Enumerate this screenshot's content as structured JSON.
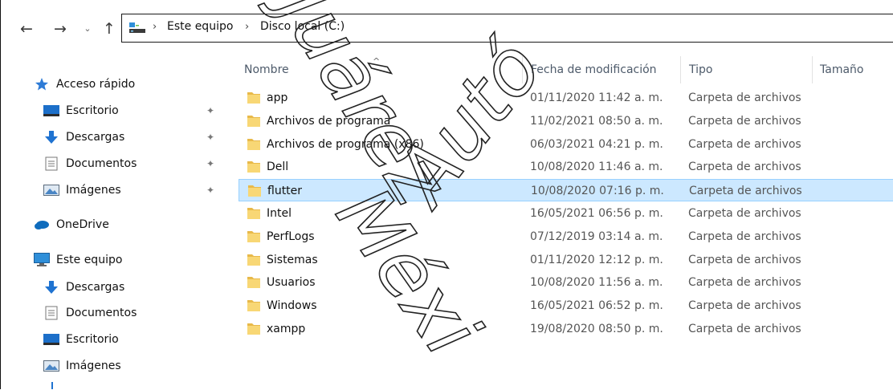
{
  "address": {
    "crumbs": [
      "Este equipo",
      "Disco local (C:)"
    ]
  },
  "nav": {
    "back": "←",
    "forward": "→",
    "recent": "⌄",
    "up": "↑",
    "separator": "›"
  },
  "sidebar": {
    "items": [
      {
        "label": "Acceso rápido",
        "icon": "star-icon",
        "pinned": false
      },
      {
        "label": "Escritorio",
        "icon": "desktop-icon",
        "pinned": true
      },
      {
        "label": "Descargas",
        "icon": "download-icon",
        "pinned": true
      },
      {
        "label": "Documentos",
        "icon": "document-icon",
        "pinned": true
      },
      {
        "label": "Imágenes",
        "icon": "pictures-icon",
        "pinned": true
      },
      {
        "label": "OneDrive",
        "icon": "cloud-icon",
        "pinned": false
      },
      {
        "label": "Este equipo",
        "icon": "computer-icon",
        "pinned": false
      },
      {
        "label": "Descargas",
        "icon": "download-icon",
        "pinned": false
      },
      {
        "label": "Documentos",
        "icon": "document-icon",
        "pinned": false
      },
      {
        "label": "Escritorio",
        "icon": "desktop-icon",
        "pinned": false
      },
      {
        "label": "Imágenes",
        "icon": "pictures-icon",
        "pinned": false
      }
    ],
    "pin_glyph": "📌"
  },
  "columns": {
    "name": "Nombre",
    "date": "Fecha de modificación",
    "type": "Tipo",
    "size": "Tamaño",
    "sort_indicator": "^"
  },
  "files": [
    {
      "name": "app",
      "date": "01/11/2020 11:42 a. m.",
      "type": "Carpeta de archivos",
      "selected": false
    },
    {
      "name": "Archivos de programa",
      "date": "11/02/2021 08:50 a. m.",
      "type": "Carpeta de archivos",
      "selected": false
    },
    {
      "name": "Archivos de programa (x86)",
      "date": "06/03/2021 04:21 p. m.",
      "type": "Carpeta de archivos",
      "selected": false
    },
    {
      "name": "Dell",
      "date": "10/08/2020 11:46 a. m.",
      "type": "Carpeta de archivos",
      "selected": false
    },
    {
      "name": "flutter",
      "date": "10/08/2020 07:16 p. m.",
      "type": "Carpeta de archivos",
      "selected": true
    },
    {
      "name": "Intel",
      "date": "16/05/2021 06:56 p. m.",
      "type": "Carpeta de archivos",
      "selected": false
    },
    {
      "name": "PerfLogs",
      "date": "07/12/2019 03:14 a. m.",
      "type": "Carpeta de archivos",
      "selected": false
    },
    {
      "name": "Sistemas",
      "date": "01/11/2020 12:12 p. m.",
      "type": "Carpeta de archivos",
      "selected": false
    },
    {
      "name": "Usuarios",
      "date": "10/08/2020 11:56 a. m.",
      "type": "Carpeta de archivos",
      "selected": false
    },
    {
      "name": "Windows",
      "date": "16/05/2021 06:52 p. m.",
      "type": "Carpeta de archivos",
      "selected": false
    },
    {
      "name": "xampp",
      "date": "19/08/2020 08:50 p. m.",
      "type": "Carpeta de archivos",
      "selected": false
    }
  ],
  "colors": {
    "selection_bg": "#cce8ff",
    "selection_border": "#99d1ff",
    "folder_yellow": "#f8d775",
    "header_text": "#4d5a6a",
    "star_blue": "#2e7bd6",
    "onedrive_blue": "#0f6cbd"
  },
  "watermark": {
    "lines": [
      "Juárez",
      "Autó",
      "Méxi"
    ]
  }
}
